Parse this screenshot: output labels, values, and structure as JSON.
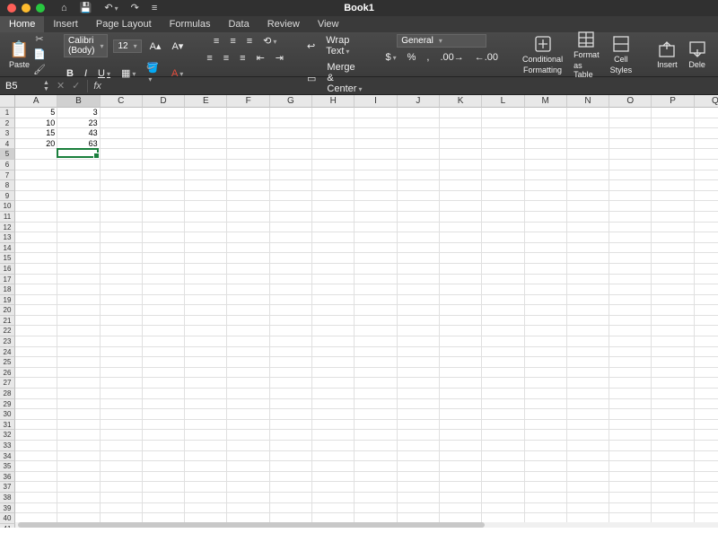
{
  "title": "Book1",
  "quick_access": {
    "home": "⌂",
    "save": "💾",
    "undo": "↶",
    "redo": "↷",
    "custom": "≡"
  },
  "tabs": [
    {
      "label": "Home",
      "active": true
    },
    {
      "label": "Insert"
    },
    {
      "label": "Page Layout"
    },
    {
      "label": "Formulas"
    },
    {
      "label": "Data"
    },
    {
      "label": "Review"
    },
    {
      "label": "View"
    }
  ],
  "ribbon": {
    "paste": "Paste",
    "font_name": "Calibri (Body)",
    "font_size": "12",
    "bold": "B",
    "italic": "I",
    "underline": "U",
    "wrap_text": "Wrap Text",
    "merge_center": "Merge & Center",
    "number_format": "General",
    "currency": "$",
    "percent": "%",
    "comma": ",",
    "inc_dec": "",
    "dec_dec": "",
    "cond_fmt": "Conditional",
    "cond_fmt2": "Formatting",
    "fmt_table": "Format",
    "fmt_table2": "as Table",
    "cell_styles": "Cell",
    "cell_styles2": "Styles",
    "insert": "Insert",
    "delete": "Dele"
  },
  "formula_bar": {
    "name_box": "B5",
    "cancel": "✕",
    "confirm": "✓",
    "fx": "fx",
    "value": ""
  },
  "columns": [
    "A",
    "B",
    "C",
    "D",
    "E",
    "F",
    "G",
    "H",
    "I",
    "J",
    "K",
    "L",
    "M",
    "N",
    "O",
    "P",
    "Q"
  ],
  "active_col_index": 1,
  "active_row_index": 4,
  "row_count": 41,
  "cell_data": {
    "A1": "5",
    "B1": "3",
    "A2": "10",
    "B2": "23",
    "A3": "15",
    "B3": "43",
    "A4": "20",
    "B4": "63"
  },
  "selection": {
    "col": 1,
    "row": 4
  }
}
